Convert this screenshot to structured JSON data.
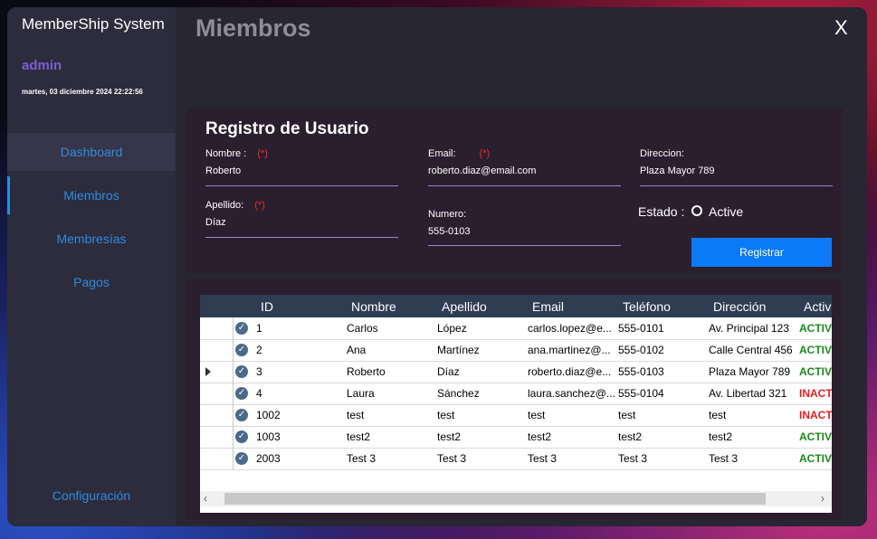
{
  "app": {
    "title": "MemberShip System",
    "user": "admin",
    "datetime": "martes, 03 diciembre 2024 22:22:56"
  },
  "nav": {
    "items": [
      {
        "label": "Dashboard"
      },
      {
        "label": "Miembros"
      },
      {
        "label": "Membresías"
      },
      {
        "label": "Pagos"
      }
    ],
    "config": "Configuración"
  },
  "page": {
    "title": "Miembros",
    "close": "X"
  },
  "form": {
    "title": "Registro de Usuario",
    "required_mark": "(*)",
    "nombre": {
      "label": "Nombre :",
      "value": "Roberto"
    },
    "apellido": {
      "label": "Apellido:",
      "value": "Díaz"
    },
    "email": {
      "label": "Email:",
      "value": "roberto.diaz@email.com"
    },
    "numero": {
      "label": "Numero:",
      "value": "555-0103"
    },
    "direccion": {
      "label": "Direccion:",
      "value": "Plaza Mayor 789"
    },
    "estado": {
      "label": "Estado :",
      "option": "Active"
    },
    "submit": "Registrar"
  },
  "grid": {
    "columns": [
      "ID",
      "Nombre",
      "Apellido",
      "Email",
      "Teléfono",
      "Dirección",
      "Activo"
    ],
    "rows": [
      {
        "id": "1",
        "nombre": "Carlos",
        "apellido": "López",
        "email": "carlos.lopez@e...",
        "telefono": "555-0101",
        "direccion": "Av. Principal 123",
        "activo": "ACTIVO"
      },
      {
        "id": "2",
        "nombre": "Ana",
        "apellido": "Martínez",
        "email": "ana.martinez@...",
        "telefono": "555-0102",
        "direccion": "Calle Central 456",
        "activo": "ACTIVO"
      },
      {
        "id": "3",
        "nombre": "Roberto",
        "apellido": "Díaz",
        "email": "roberto.diaz@e...",
        "telefono": "555-0103",
        "direccion": "Plaza Mayor 789",
        "activo": "ACTIVO"
      },
      {
        "id": "4",
        "nombre": "Laura",
        "apellido": "Sánchez",
        "email": "laura.sanchez@...",
        "telefono": "555-0104",
        "direccion": "Av. Libertad 321",
        "activo": "INACTIVO"
      },
      {
        "id": "1002",
        "nombre": "test",
        "apellido": "test",
        "email": "test",
        "telefono": "test",
        "direccion": "test",
        "activo": "INACTIVO"
      },
      {
        "id": "1003",
        "nombre": "test2",
        "apellido": "test2",
        "email": "test2",
        "telefono": "test2",
        "direccion": "test2",
        "activo": "ACTIVO"
      },
      {
        "id": "2003",
        "nombre": "Test 3",
        "apellido": "Test 3",
        "email": "Test 3",
        "telefono": "Test 3",
        "direccion": "Test 3",
        "activo": "ACTIVO"
      }
    ]
  },
  "colors": {
    "accent": "#0a7af6",
    "nav_text": "#2f8bde",
    "active": "#1a8a1a",
    "inactive": "#e02020"
  }
}
